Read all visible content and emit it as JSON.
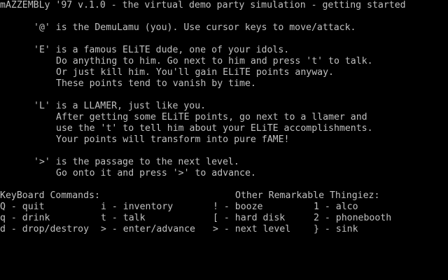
{
  "title_line": "mAZZEMBLy '97 v.1.0 - the virtual demo party simulation - getting started",
  "intro": {
    "player": "'@' is the DemuLamu (you). Use cursor keys to move/attack.",
    "elite": [
      "'E' is a famous ELiTE dude, one of your idols.",
      "Do anything to him. Go next to him and press 't' to talk.",
      "Or just kill him. You'll gain ELiTE points anyway.",
      "These points tend to vanish by time."
    ],
    "llamer": [
      "'L' is a LLAMER, just like you.",
      "After getting some ELiTE points, go next to a llamer and",
      "use the 't' to tell him about your ELiTE accomplishments.",
      "Your points will transform into pure fAME!"
    ],
    "passage": [
      "'>' is the passage to the next level.",
      "Go onto it and press '>' to advance."
    ]
  },
  "keyboard": {
    "heading": "KeyBoard Commands:",
    "col1": [
      "Q - quit",
      "q - drink",
      "d - drop/destroy"
    ],
    "col2": [
      "i - inventory",
      "t - talk",
      "> - enter/advance"
    ]
  },
  "thingiez": {
    "heading": "Other Remarkable Thingiez:",
    "col1": [
      "! - booze",
      "[ - hard disk",
      "> - next level"
    ],
    "col2": [
      "1 - alco",
      "2 - phonebooth",
      "} - sink"
    ]
  }
}
